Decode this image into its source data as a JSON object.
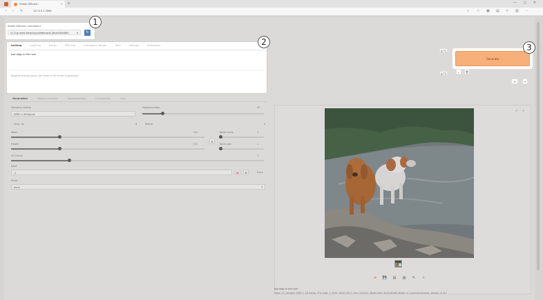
{
  "browser": {
    "tab_title": "Stable Diffusion",
    "url": "127.0.0.1:7860",
    "close_glyph": "×",
    "newtab_glyph": "+",
    "window_controls": "— ▢ ✕"
  },
  "checkpoint": {
    "label": "Stable Diffusion checkpoint",
    "value": "v1-5-pruned-emaonly.safetensors [6ce0161689]"
  },
  "main_tabs": [
    "txt2img",
    "img2img",
    "Extras",
    "PNG Info",
    "Checkpoint Merger",
    "Train",
    "Settings",
    "Extensions"
  ],
  "prompt": {
    "positive": "two dogs in the river",
    "negative": "Negative prompt (press Ctrl+Enter or Alt+Enter to generate)"
  },
  "generate_label": "Generate",
  "markers": [
    "1",
    "2",
    "3"
  ],
  "lower_tabs": [
    "Generation",
    "Textual Inversion",
    "Hypernetworks",
    "Checkpoints",
    "Lora"
  ],
  "settings": {
    "sampling_method_label": "Sampling method",
    "sampling_method_value": "DPM++ 2M Karras",
    "sampling_steps_label": "Sampling steps",
    "sampling_steps_value": "20",
    "hires_label": "Hires. fix",
    "refiner_label": "Refiner",
    "width_label": "Width",
    "width_value": "512",
    "height_label": "Height",
    "height_value": "512",
    "batch_count_label": "Batch count",
    "batch_count_value": "1",
    "batch_size_label": "Batch size",
    "batch_size_value": "1",
    "cfg_label": "CFG Scale",
    "cfg_value": "7",
    "seed_label": "Seed",
    "seed_value": "-1",
    "extra_label": "Extra",
    "script_label": "Script",
    "script_value": "None"
  },
  "slider_levels": {
    "sampling_steps": 0.17,
    "width": 0.25,
    "height": 0.25,
    "batch_count": 0.02,
    "batch_size": 0.02,
    "cfg": 0.23
  },
  "output": {
    "info_prompt": "two dogs in the river",
    "info_params": "Steps: 20, Sampler: DPM++ 2M Karras, CFG scale: 7, Seed: 2024179117, Size: 512x512, Model hash: 6ce0161689, Model: v1-5-pruned-emaonly, Version: v1.6.0",
    "tool_icons": [
      "folder-icon",
      "save-icon",
      "zip-icon",
      "image-icon",
      "brush-icon",
      "extras-icon"
    ]
  },
  "colors": {
    "generate_bg": "#f7b07a",
    "generate_border": "#ef9454",
    "refresh_btn": "#4a7fc1"
  }
}
